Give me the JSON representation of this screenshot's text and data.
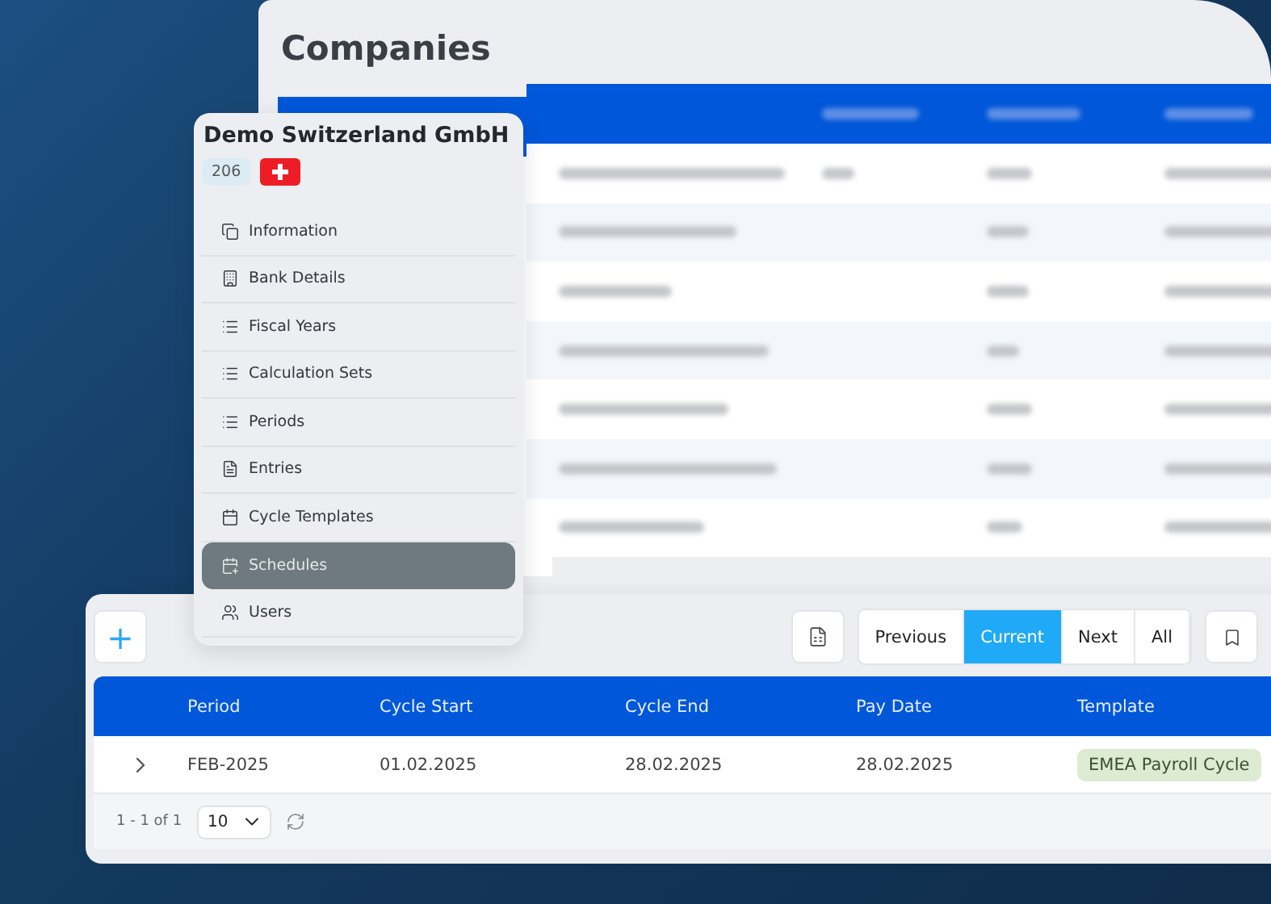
{
  "companies": {
    "title": "Companies"
  },
  "company_panel": {
    "title": "Demo Switzerland GmbH",
    "id_badge": "206",
    "menu": [
      {
        "label": "Information",
        "selected": false
      },
      {
        "label": "Bank Details",
        "selected": false
      },
      {
        "label": "Fiscal Years",
        "selected": false
      },
      {
        "label": "Calculation Sets",
        "selected": false
      },
      {
        "label": "Periods",
        "selected": false
      },
      {
        "label": "Entries",
        "selected": false
      },
      {
        "label": "Cycle Templates",
        "selected": false
      },
      {
        "label": "Schedules",
        "selected": true
      },
      {
        "label": "Users",
        "selected": false
      }
    ]
  },
  "schedules": {
    "add_button": "+",
    "filters": [
      {
        "label": "Previous",
        "selected": false
      },
      {
        "label": "Current",
        "selected": true
      },
      {
        "label": "Next",
        "selected": false
      },
      {
        "label": "All",
        "selected": false
      }
    ],
    "columns": [
      "Period",
      "Cycle Start",
      "Cycle End",
      "Pay Date",
      "Template"
    ],
    "rows": [
      {
        "period": "FEB-2025",
        "cycle_start": "01.02.2025",
        "cycle_end": "28.02.2025",
        "pay_date": "28.02.2025",
        "template": "EMEA Payroll Cycle"
      }
    ],
    "pagination": "1 - 1 of 1",
    "page_size": "10"
  }
}
